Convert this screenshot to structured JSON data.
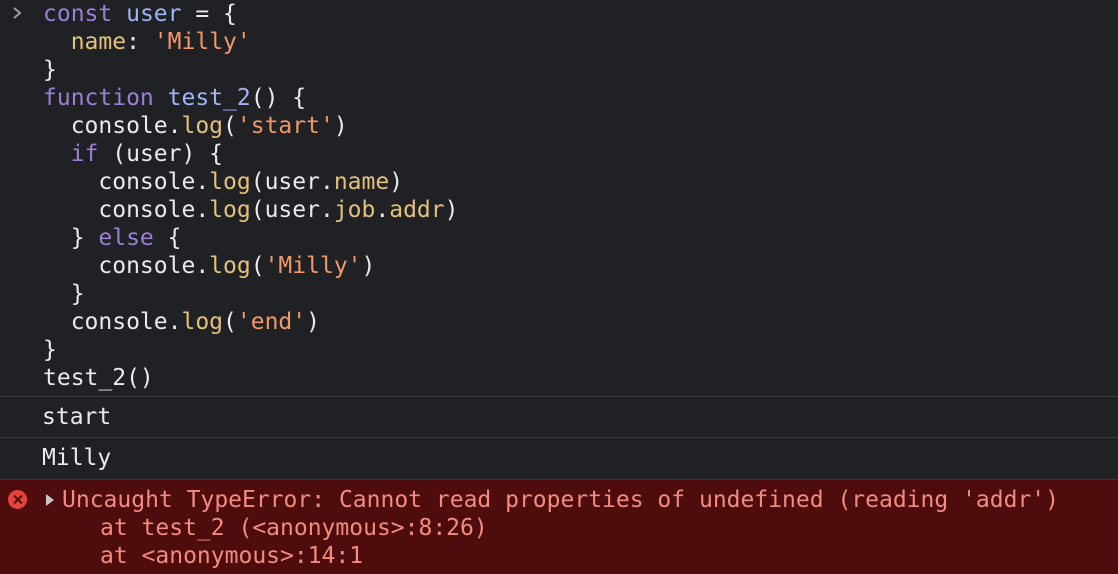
{
  "input": {
    "prompt_icon": "chevron-right-icon",
    "lines": [
      [
        {
          "t": "kw",
          "v": "const "
        },
        {
          "t": "def",
          "v": "user"
        },
        {
          "t": "op",
          "v": " = {"
        }
      ],
      [
        {
          "t": "plain",
          "v": "  "
        },
        {
          "t": "prop",
          "v": "name"
        },
        {
          "t": "op",
          "v": ": "
        },
        {
          "t": "str",
          "v": "'Milly'"
        }
      ],
      [
        {
          "t": "op",
          "v": "}"
        }
      ],
      [
        {
          "t": "kw",
          "v": "function "
        },
        {
          "t": "fn",
          "v": "test_2"
        },
        {
          "t": "op",
          "v": "() {"
        }
      ],
      [
        {
          "t": "plain",
          "v": "  console."
        },
        {
          "t": "prop",
          "v": "log"
        },
        {
          "t": "op",
          "v": "("
        },
        {
          "t": "str",
          "v": "'start'"
        },
        {
          "t": "op",
          "v": ")"
        }
      ],
      [
        {
          "t": "plain",
          "v": "  "
        },
        {
          "t": "kw",
          "v": "if"
        },
        {
          "t": "op",
          "v": " (user) {"
        }
      ],
      [
        {
          "t": "plain",
          "v": "    console."
        },
        {
          "t": "prop",
          "v": "log"
        },
        {
          "t": "op",
          "v": "(user."
        },
        {
          "t": "prop",
          "v": "name"
        },
        {
          "t": "op",
          "v": ")"
        }
      ],
      [
        {
          "t": "plain",
          "v": "    console."
        },
        {
          "t": "prop",
          "v": "log"
        },
        {
          "t": "op",
          "v": "(user."
        },
        {
          "t": "prop",
          "v": "job"
        },
        {
          "t": "op",
          "v": "."
        },
        {
          "t": "prop",
          "v": "addr"
        },
        {
          "t": "op",
          "v": ")"
        }
      ],
      [
        {
          "t": "plain",
          "v": "  } "
        },
        {
          "t": "kw",
          "v": "else"
        },
        {
          "t": "op",
          "v": " {"
        }
      ],
      [
        {
          "t": "plain",
          "v": "    console."
        },
        {
          "t": "prop",
          "v": "log"
        },
        {
          "t": "op",
          "v": "("
        },
        {
          "t": "str",
          "v": "'Milly'"
        },
        {
          "t": "op",
          "v": ")"
        }
      ],
      [
        {
          "t": "plain",
          "v": "  }"
        }
      ],
      [
        {
          "t": "plain",
          "v": "  console."
        },
        {
          "t": "prop",
          "v": "log"
        },
        {
          "t": "op",
          "v": "("
        },
        {
          "t": "str",
          "v": "'end'"
        },
        {
          "t": "op",
          "v": ")"
        }
      ],
      [
        {
          "t": "op",
          "v": "}"
        }
      ],
      [
        {
          "t": "plain",
          "v": "test_2()"
        }
      ]
    ]
  },
  "logs": [
    {
      "text": "start"
    },
    {
      "text": "Milly"
    }
  ],
  "error": {
    "icon": "error-circle-icon",
    "expand_icon": "triangle-right-icon",
    "message": "Uncaught TypeError: Cannot read properties of undefined (reading 'addr')",
    "stack": [
      "at test_2 (<anonymous>:8:26)",
      "at <anonymous>:14:1"
    ]
  },
  "colors": {
    "background": "#202124",
    "keyword": "#9a7fd5",
    "definition": "#9fb4f7",
    "property": "#e3c17b",
    "string": "#f29766",
    "error_background": "#4e0c0c",
    "error_text": "#f28b82"
  }
}
